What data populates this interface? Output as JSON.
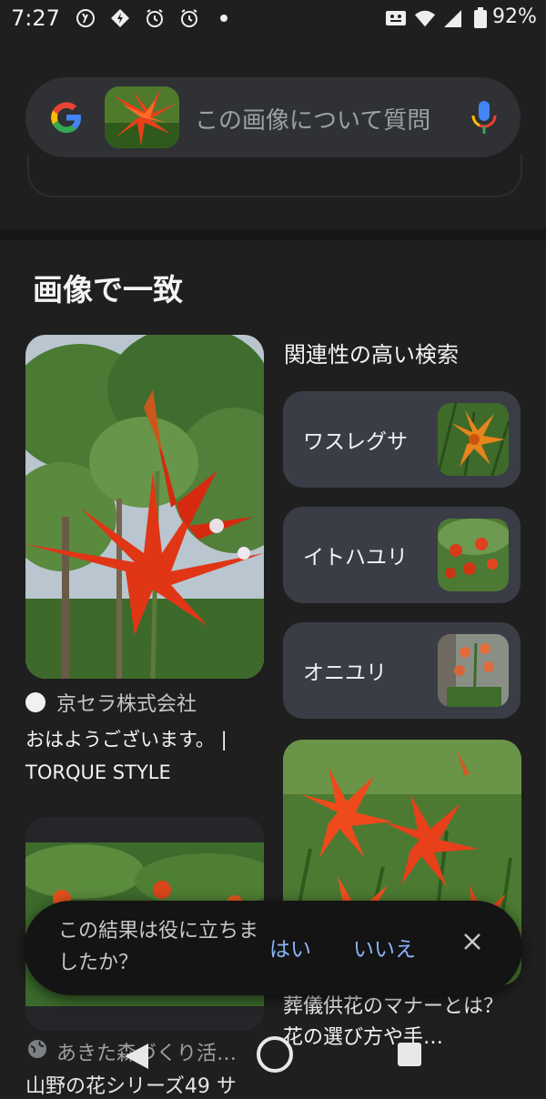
{
  "status_bar": {
    "time": "7:27",
    "battery": "92%"
  },
  "search": {
    "placeholder": "この画像について質問"
  },
  "section": {
    "title": "画像で一致"
  },
  "result1": {
    "source": "京セラ株式会社",
    "title": "おはようございます。 | TORQUE STYLE"
  },
  "related": {
    "title": "関連性の高い検索",
    "items": [
      {
        "label": "ワスレグサ"
      },
      {
        "label": "イトハユリ"
      },
      {
        "label": "オニユリ"
      }
    ]
  },
  "result2": {
    "title": "葬儀供花のマナーとは？花の選び方や手…"
  },
  "result3": {
    "source": "あきた森づくり活…",
    "title": "山野の花シリーズ49 サ"
  },
  "feedback": {
    "question": "この結果は役に立ちましたか？",
    "yes": "はい",
    "no": "いいえ"
  }
}
